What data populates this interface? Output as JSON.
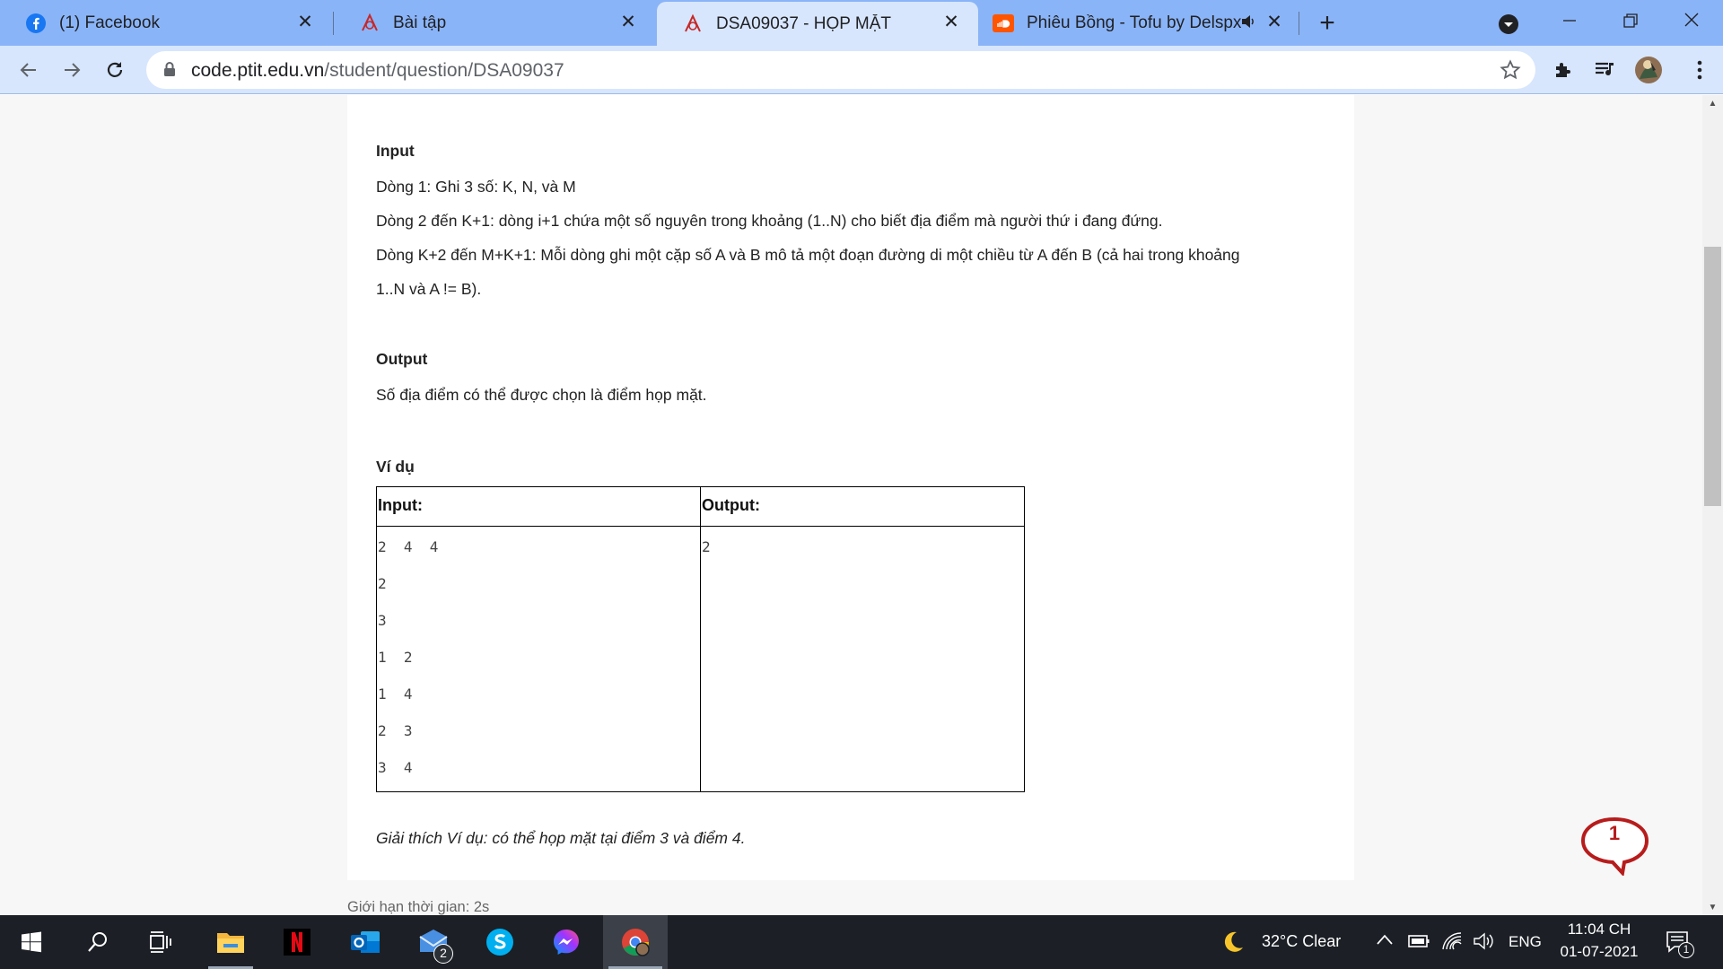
{
  "tabs": [
    {
      "title": "(1) Facebook",
      "icon": "facebook-icon"
    },
    {
      "title": "Bài tập",
      "icon": "ptit-icon"
    },
    {
      "title": "DSA09037 - HỌP MẶT",
      "icon": "ptit-icon",
      "active": true
    },
    {
      "title": "Phiêu Bồng - Tofu by Delspx",
      "icon": "soundcloud-icon",
      "audio": true
    }
  ],
  "toolbar": {
    "url_host": "code.ptit.edu.vn",
    "url_path": "/student/question/DSA09037"
  },
  "problem": {
    "input_heading": "Input",
    "input_lines": [
      "Dòng 1: Ghi 3 số: K, N, và M",
      "Dòng 2 đến K+1: dòng i+1 chứa một số nguyên trong khoảng (1..N) cho biết địa điểm mà người thứ i đang đứng.",
      "Dòng K+2 đến M+K+1: Mỗi dòng ghi một cặp số A và B mô tả một đoạn đường di một chiều từ A đến B (cả hai trong khoảng",
      "1..N và A != B)."
    ],
    "output_heading": "Output",
    "output_text": "Số địa điểm có thể được chọn là điểm họp mặt.",
    "example_heading": "Ví dụ",
    "table": {
      "headers": [
        "Input:",
        "Output:"
      ],
      "input_lines": [
        "2  4  4",
        "2",
        "3",
        "1  2",
        "1  4",
        "2  3",
        "3  4"
      ],
      "output_lines": [
        "2"
      ]
    },
    "explanation": "Giải thích Ví dụ: có thể họp mặt tại điểm 3 và điểm 4.",
    "time_limit": "Giới hạn thời gian: 2s"
  },
  "chat": {
    "count": "1"
  },
  "taskbar": {
    "weather": "32°C  Clear",
    "language": "ENG",
    "time": "11:04 CH",
    "date": "01-07-2021",
    "mail_badge": "2",
    "notification_badge": "1"
  },
  "colors": {
    "tabstrip": "#8ab4f8",
    "toolbar": "#d7e6fd",
    "taskbar": "#1c2026",
    "chat": "#b71c1c"
  }
}
